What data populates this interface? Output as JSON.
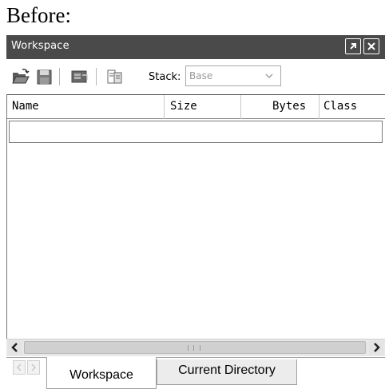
{
  "caption": "Before:",
  "window": {
    "title": "Workspace",
    "undock_icon": "undock-arrow-icon",
    "close_icon": "close-icon"
  },
  "toolbar": {
    "icons": [
      "open-folder-icon",
      "save-icon",
      "import-data-icon",
      "print-icon"
    ],
    "stack_label": "Stack:",
    "stack_value": "Base"
  },
  "table": {
    "columns": [
      "Name",
      "Size",
      "Bytes",
      "Class"
    ],
    "rows": []
  },
  "tabs": {
    "items": [
      {
        "label": "Workspace",
        "active": true
      },
      {
        "label": "Current Directory",
        "active": false
      }
    ]
  },
  "colors": {
    "titlebar": "#4a4a4a",
    "inactive_tab": "#ececec",
    "scrollbar": "#e8e8e8"
  }
}
